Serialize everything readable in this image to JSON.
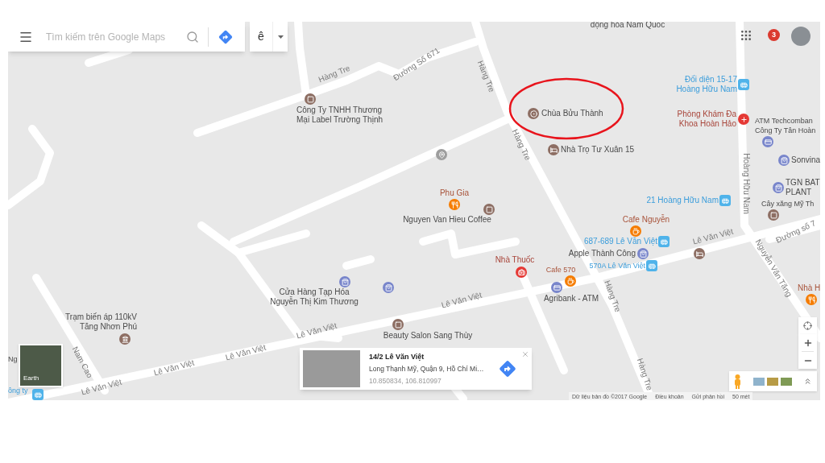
{
  "search": {
    "placeholder": "Tìm kiếm trên Google Maps"
  },
  "account": {
    "initial": "ê"
  },
  "notifications": {
    "count": "3"
  },
  "earth_toggle": {
    "label": "Earth"
  },
  "info_card": {
    "title": "14/2 Lê Văn Việt",
    "address": "Long Thạnh Mỹ, Quận 9, Hồ Chí Mi…",
    "coordinates": "10.850834, 106.810997"
  },
  "attribution": [
    "Dữ liệu bản đồ ©2017 Google",
    "Điều khoản",
    "Gửi phản hồi",
    "50 mét"
  ],
  "map_labels": [
    {
      "kind": "road",
      "text": "Hàng Tre"
    },
    {
      "kind": "road",
      "text": "Đường Số 671"
    },
    {
      "kind": "road",
      "text": "Hàng Tre"
    },
    {
      "kind": "road",
      "text": "Hàng Tre"
    },
    {
      "kind": "road",
      "text": "Hoàng Hữu Nam"
    },
    {
      "kind": "road",
      "text": "Lê Văn Việt"
    },
    {
      "kind": "road",
      "text": "Đường số 7"
    },
    {
      "kind": "road",
      "text": "Nguyễn Văn Tăng"
    },
    {
      "kind": "road",
      "text": "Hàng Tre"
    },
    {
      "kind": "road",
      "text": "Hàng Tre"
    },
    {
      "kind": "road",
      "text": "Lê Văn Việt"
    },
    {
      "kind": "road",
      "text": "Lê Văn Việt"
    },
    {
      "kind": "road",
      "text": "Lê Văn Việt"
    },
    {
      "kind": "road",
      "text": "Lê Văn Việt"
    },
    {
      "kind": "road",
      "text": "Lê Văn Việt"
    },
    {
      "kind": "road",
      "text": "Nam Cao"
    },
    {
      "kind": "place",
      "text": "động hóa Nam Quốc"
    },
    {
      "kind": "place",
      "text": "Công Ty TNHH Thương\nMại Label Trường Thịnh"
    },
    {
      "kind": "place",
      "text": "Chùa Bửu Thành"
    },
    {
      "kind": "place",
      "text": "Nhà Trọ Tư Xuân 15"
    },
    {
      "kind": "transit",
      "text": "Đối diện 15-17\nHoàng Hữu Nam"
    },
    {
      "kind": "health",
      "text": "Phòng Khám Đa\nKhoa Hoàn Hảo"
    },
    {
      "kind": "place",
      "text": "ATM Techcomban\nCông Ty Tân Hoàn"
    },
    {
      "kind": "place",
      "text": "Sonvina"
    },
    {
      "kind": "place",
      "text": "TGN BAT\nPLANT"
    },
    {
      "kind": "place",
      "text": "Cây xăng Mỹ Th"
    },
    {
      "kind": "transit",
      "text": "21 Hoàng Hữu Nam"
    },
    {
      "kind": "eatery",
      "text": "Cafe Nguyễn"
    },
    {
      "kind": "transit",
      "text": "687-689 Lê Văn Việt"
    },
    {
      "kind": "place",
      "text": "Apple Thành Công"
    },
    {
      "kind": "transit",
      "text": "570A Lê Văn Việt"
    },
    {
      "kind": "place"
    },
    {
      "kind": "health",
      "text": "Nhà Thuốc"
    },
    {
      "kind": "eatery",
      "text": "Cafe 570"
    },
    {
      "kind": "place",
      "text": "Agribank - ATM"
    },
    {
      "kind": "eatery",
      "text": "Nhà H"
    },
    {
      "kind": "eatery",
      "text": "Phu Gia"
    },
    {
      "kind": "place",
      "text": "Nguyen Van Hieu Coffee"
    },
    {
      "kind": "place"
    },
    {
      "kind": "place",
      "text": "Cửa Hàng Tạp Hóa\nNguyễn Thị Kim Thương"
    },
    {
      "kind": "place"
    },
    {
      "kind": "place",
      "text": "Beauty Salon Sang Thùy"
    },
    {
      "kind": "place",
      "text": "Trạm biến áp 110kV\nTăng Nhơn Phú"
    },
    {
      "kind": "place",
      "text": "Ng"
    },
    {
      "kind": "transit",
      "text": "ông ty"
    }
  ]
}
